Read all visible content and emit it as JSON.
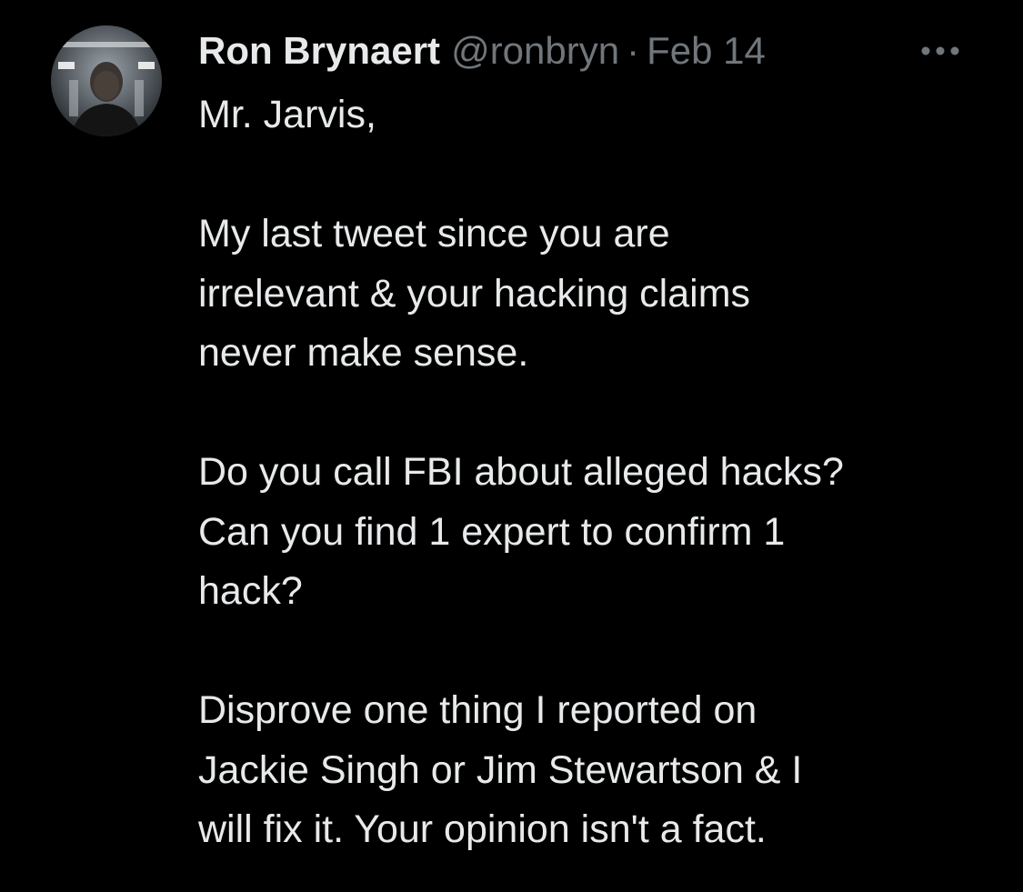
{
  "author": {
    "name": "Ron Brynaert",
    "handle": "@ronbryn",
    "separator": "·",
    "date": "Feb 14"
  },
  "more_icon": "more-horizontal-icon",
  "body_lines": [
    "Mr. Jarvis,",
    "",
    "My last tweet since you are",
    "irrelevant & your hacking claims",
    "never make sense.",
    "",
    "Do you call FBI about alleged hacks?",
    "Can you find 1 expert to confirm 1",
    "hack?",
    "",
    "Disprove one thing I reported on",
    "Jackie Singh or Jim Stewartson & I",
    "will fix it. Your opinion isn't a fact."
  ],
  "colors": {
    "background": "#000000",
    "primary_text": "#e7e9ea",
    "secondary_text": "#71767b"
  }
}
